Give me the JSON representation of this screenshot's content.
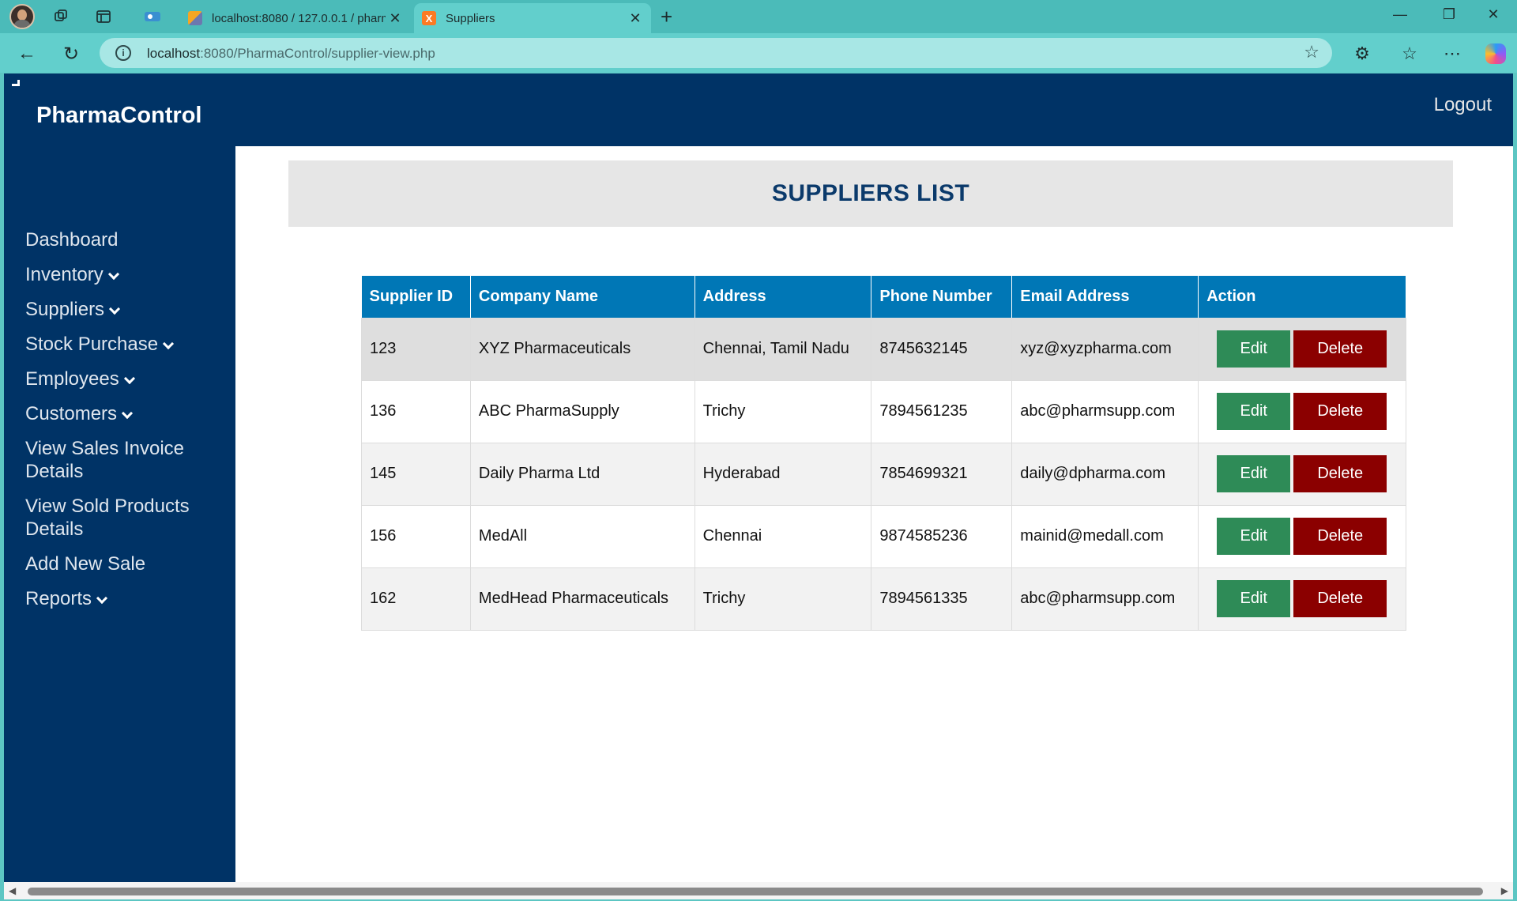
{
  "browser": {
    "tabs": [
      {
        "title": "localhost:8080 / 127.0.0.1 / pharm",
        "active": false
      },
      {
        "title": "Suppliers",
        "active": true
      }
    ],
    "url_host": "localhost",
    "url_rest": ":8080/PharmaControl/supplier-view.php",
    "xampp_glyph": "X"
  },
  "header": {
    "brand": "PharmaControl",
    "logout": "Logout"
  },
  "sidebar": {
    "items": [
      {
        "label": "Dashboard",
        "dropdown": false
      },
      {
        "label": "Inventory",
        "dropdown": true
      },
      {
        "label": "Suppliers",
        "dropdown": true
      },
      {
        "label": "Stock Purchase",
        "dropdown": true
      },
      {
        "label": "Employees",
        "dropdown": true
      },
      {
        "label": "Customers",
        "dropdown": true
      },
      {
        "label": "View Sales Invoice Details",
        "dropdown": false
      },
      {
        "label": "View Sold Products Details",
        "dropdown": false
      },
      {
        "label": "Add New Sale",
        "dropdown": false
      },
      {
        "label": "Reports",
        "dropdown": true
      }
    ]
  },
  "main": {
    "title": "SUPPLIERS LIST",
    "table": {
      "columns": [
        "Supplier ID",
        "Company Name",
        "Address",
        "Phone Number",
        "Email Address",
        "Action"
      ],
      "rows": [
        [
          "123",
          "XYZ Pharmaceuticals",
          "Chennai, Tamil Nadu",
          "8745632145",
          "xyz@xyzpharma.com"
        ],
        [
          "136",
          "ABC PharmaSupply",
          "Trichy",
          "7894561235",
          "abc@pharmsupp.com"
        ],
        [
          "145",
          "Daily Pharma Ltd",
          "Hyderabad",
          "7854699321",
          "daily@dpharma.com"
        ],
        [
          "156",
          "MedAll",
          "Chennai",
          "9874585236",
          "mainid@medall.com"
        ],
        [
          "162",
          "MedHead Pharmaceuticals",
          "Trichy",
          "7894561335",
          "abc@pharmsupp.com"
        ]
      ],
      "edit_label": "Edit",
      "delete_label": "Delete"
    }
  },
  "colors": {
    "navy": "#003366",
    "table_header": "#0077b6",
    "edit": "#2e8b57",
    "delete": "#8b0000"
  }
}
